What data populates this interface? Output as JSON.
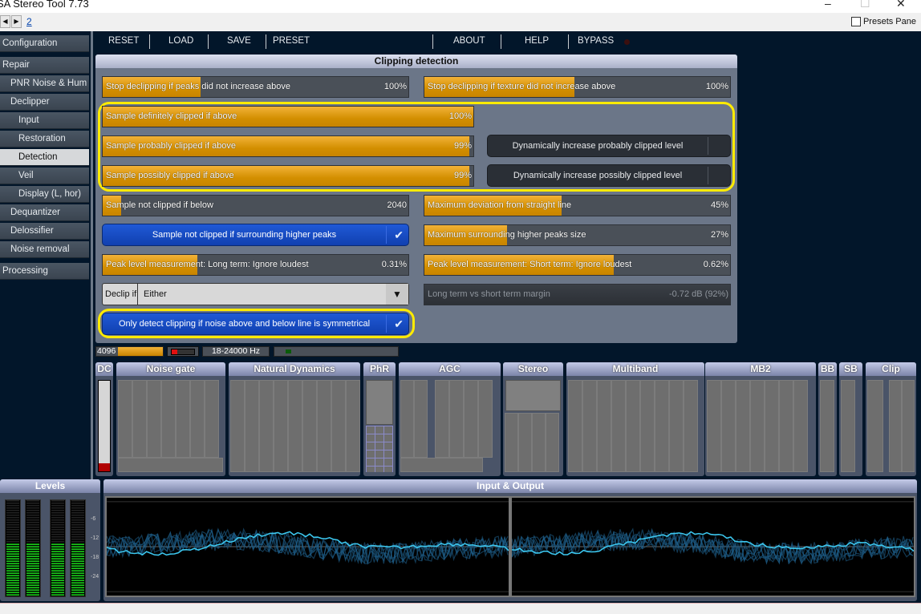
{
  "window": {
    "title": "SA Stereo Tool 7.73",
    "minimize": "–",
    "maximize": "☐",
    "close": "✕"
  },
  "nav": {
    "back": "◀",
    "forward": "▶",
    "page_link": "2",
    "presets_pane_label": "Presets Pane",
    "presets_pane_checked": false
  },
  "sidebar": {
    "items": [
      {
        "label": "Configuration"
      },
      {
        "label": "Repair"
      },
      {
        "label": "PNR Noise & Hum"
      },
      {
        "label": "Declipper"
      },
      {
        "label": "Input"
      },
      {
        "label": "Restoration"
      },
      {
        "label": "Detection",
        "active": true
      },
      {
        "label": "Veil"
      },
      {
        "label": "Display (L, hor)"
      },
      {
        "label": "Dequantizer"
      },
      {
        "label": "Delossifier"
      },
      {
        "label": "Noise removal"
      },
      {
        "label": "Processing"
      }
    ]
  },
  "toolbar": {
    "reset": "RESET",
    "load": "LOAD",
    "save": "SAVE",
    "preset": "PRESET",
    "about": "ABOUT",
    "help": "HELP",
    "bypass": "BYPASS"
  },
  "panel": {
    "title": "Clipping detection",
    "sliders": {
      "stop_peaks": {
        "label": "Stop declipping if peaks did not increase above",
        "value": "100%",
        "fill": 0.32
      },
      "stop_texture": {
        "label": "Stop declipping if texture did not increase above",
        "value": "100%",
        "fill": 0.49
      },
      "definitely": {
        "label": "Sample definitely clipped if above",
        "value": "100%",
        "fill": 1.0
      },
      "probably": {
        "label": "Sample probably clipped if above",
        "value": "99%",
        "fill": 0.99
      },
      "possibly": {
        "label": "Sample possibly clipped if above",
        "value": "99%",
        "fill": 0.99
      },
      "not_clipped_below": {
        "label": "Sample not clipped if below",
        "value": "2040",
        "fill": 0.06
      },
      "max_deviation": {
        "label": "Maximum deviation from straight line",
        "value": "45%",
        "fill": 0.45
      },
      "max_surrounding": {
        "label": "Maximum surrounding higher peaks size",
        "value": "27%",
        "fill": 0.27
      },
      "peak_long": {
        "label": "Peak level measurement: Long term: Ignore loudest",
        "value": "0.31%",
        "fill": 0.31
      },
      "peak_short": {
        "label": "Peak level measurement: Short term: Ignore loudest",
        "value": "0.62%",
        "fill": 0.62
      },
      "margin": {
        "label": "Long term vs short term margin",
        "value": "-0.72 dB (92%)",
        "fill": 0.92,
        "disabled": true
      }
    },
    "toggles": {
      "dyn_probably": {
        "label": "Dynamically increase probably clipped level",
        "checked": false
      },
      "dyn_possibly": {
        "label": "Dynamically increase possibly clipped level",
        "checked": false
      },
      "surrounding": {
        "label": "Sample not clipped if surrounding higher peaks",
        "checked": true
      },
      "symmetrical": {
        "label": "Only detect clipping if noise above and below line is symmetrical",
        "checked": true
      }
    },
    "declip_if": {
      "label": "Declip if",
      "value": "Either"
    },
    "check_glyph": "✔",
    "dropdown_glyph": "▼"
  },
  "status_strip": {
    "buffer": "4096",
    "freq_range": "18-24000 Hz"
  },
  "modules": [
    "DC",
    "Noise gate",
    "Natural Dynamics",
    "PhR",
    "AGC",
    "Stereo",
    "Multiband",
    "MB2",
    "BB",
    "SB",
    "Clip"
  ],
  "levels": {
    "title": "Levels",
    "scale": [
      "-6",
      "-12",
      "-18",
      "-24"
    ]
  },
  "io": {
    "title": "Input & Output"
  },
  "colors": {
    "accent_orange": "#e0a020",
    "toggle_blue": "#1a4fd0",
    "highlight_yellow": "#ffeb00",
    "meter_green": "#1fbf1f",
    "scope_cyan": "#3cc8f0"
  }
}
